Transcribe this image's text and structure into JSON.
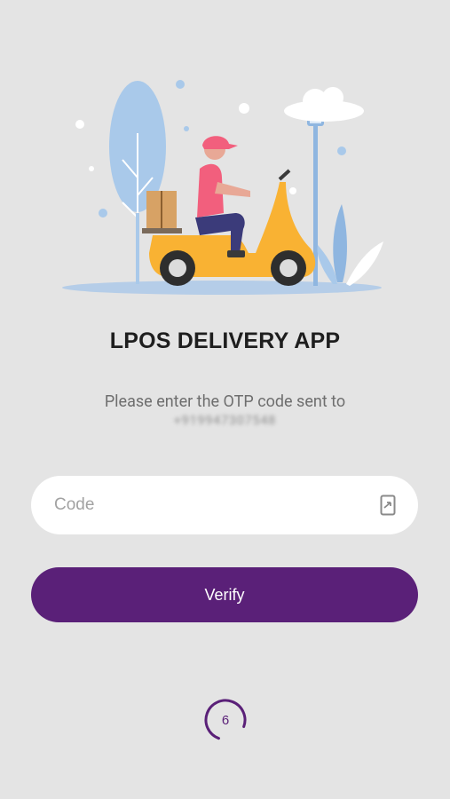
{
  "app": {
    "title": "LPOS DELIVERY APP"
  },
  "otp": {
    "message": "Please enter the OTP code sent to",
    "phone_masked": "+919947307548"
  },
  "code_field": {
    "placeholder": "Code",
    "value": "",
    "icon": "sms-phone-icon"
  },
  "verify_button": {
    "label": "Verify"
  },
  "countdown": {
    "value": "6"
  },
  "colors": {
    "background": "#e4e4e4",
    "primary": "#5a2078",
    "field_bg": "#ffffff",
    "scooter": "#f9b233",
    "shirt": "#f25f7d"
  }
}
